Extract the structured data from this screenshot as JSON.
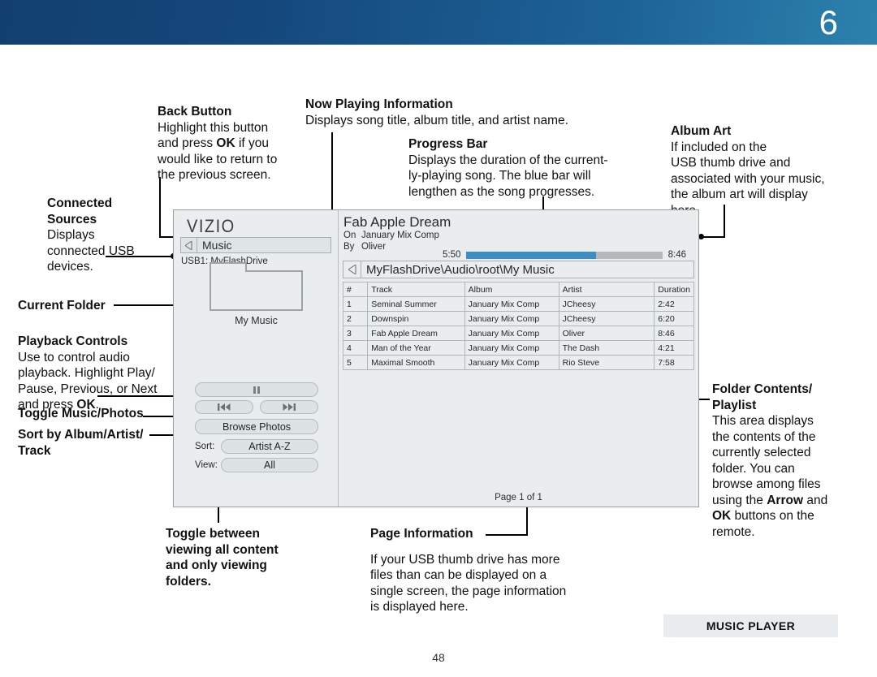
{
  "header": {
    "chapter_number": "6"
  },
  "footer": {
    "badge": "MUSIC PLAYER",
    "page_number": "48"
  },
  "annotations": {
    "back_button": {
      "title": "Back Button",
      "body_1": "Highlight this button",
      "body_2": "and press ",
      "body_2_bold": "OK",
      "body_2_end": " if you",
      "body_3": "would like to return to",
      "body_4": "the previous screen."
    },
    "now_playing": {
      "title": "Now Playing Information",
      "body": "Displays song title, album title, and artist name."
    },
    "progress_bar": {
      "title": "Progress Bar",
      "body_1": "Displays the duration of the current-",
      "body_2": "ly-playing song. The blue bar will",
      "body_3": "lengthen as the song progresses."
    },
    "album_art": {
      "title": "Album Art",
      "body_1": "If included on the",
      "body_2": "USB thumb drive and",
      "body_3": "associated with your music,",
      "body_4": "the album art will display",
      "body_5": "here."
    },
    "connected_sources": {
      "title_1": "Connected",
      "title_2": "Sources",
      "body_1": "Displays",
      "body_2": "connected USB",
      "body_3": "devices."
    },
    "current_folder": {
      "title": "Current Folder"
    },
    "playback_controls": {
      "title": "Playback Controls",
      "body_1": "Use to control audio",
      "body_2": "playback. Highlight Play/",
      "body_3": "Pause, Previous, or Next",
      "body_4_pre": "and press ",
      "body_4_bold": "OK",
      "body_4_post": "."
    },
    "toggle_music_photos": {
      "title": "Toggle Music/Photos"
    },
    "sort_by": {
      "title_1": "Sort by Album/Artist/",
      "title_2": "Track"
    },
    "toggle_view": {
      "line_1": "Toggle between",
      "line_2": "viewing all content",
      "line_3": "and only viewing",
      "line_4": "folders."
    },
    "page_information": {
      "title": "Page Information",
      "body_1": "If your USB thumb drive has more",
      "body_2": "files than can be displayed on a",
      "body_3": "single screen, the page information",
      "body_4": "is displayed here."
    },
    "folder_contents": {
      "title_1": "Folder Contents/",
      "title_2": "Playlist",
      "body_1": "This area displays",
      "body_2": "the contents of the",
      "body_3": "currently selected",
      "body_4": "folder. You can",
      "body_5": "browse among files",
      "body_6_pre": "using the ",
      "body_6_bold": "Arrow",
      "body_6_post": " and",
      "body_7_bold": "OK",
      "body_7_post": " buttons on the",
      "body_8": "remote."
    }
  },
  "tv": {
    "brand": "VIZIO",
    "screen_title": "Music",
    "usb_label": "USB1: MyFlashDrive",
    "folder_name": "My Music",
    "now_playing": {
      "song_title": "Fab Apple Dream",
      "on_key": "On",
      "album": "January Mix Comp",
      "by_key": "By",
      "artist": "Oliver",
      "elapsed": "5:50",
      "total": "8:46",
      "progress_percent": 66
    },
    "path": "MyFlashDrive\\Audio\\root\\My Music",
    "table": {
      "columns": [
        "#",
        "Track",
        "Album",
        "Artist",
        "Duration"
      ],
      "rows": [
        [
          "1",
          "Seminal Summer",
          "January Mix Comp",
          "JCheesy",
          "2:42"
        ],
        [
          "2",
          "Downspin",
          "January Mix Comp",
          "JCheesy",
          "6:20"
        ],
        [
          "3",
          "Fab Apple Dream",
          "January Mix Comp",
          "Oliver",
          "8:46"
        ],
        [
          "4",
          "Man of the Year",
          "January Mix Comp",
          "The Dash",
          "4:21"
        ],
        [
          "5",
          "Maximal Smooth",
          "January Mix Comp",
          "Rio Steve",
          "7:58"
        ]
      ]
    },
    "page_info": "Page 1 of 1",
    "controls": {
      "play_pause": "play-pause",
      "previous": "previous",
      "next": "next",
      "browse_photos": "Browse Photos",
      "sort_label": "Sort:",
      "sort_value": "Artist A-Z",
      "view_label": "View:",
      "view_value": "All"
    }
  },
  "colors": {
    "banner_dark": "#123f6e",
    "banner_light": "#2c82ad",
    "progress_fill": "#3f8dc0",
    "screen_bg": "#e9edee"
  }
}
